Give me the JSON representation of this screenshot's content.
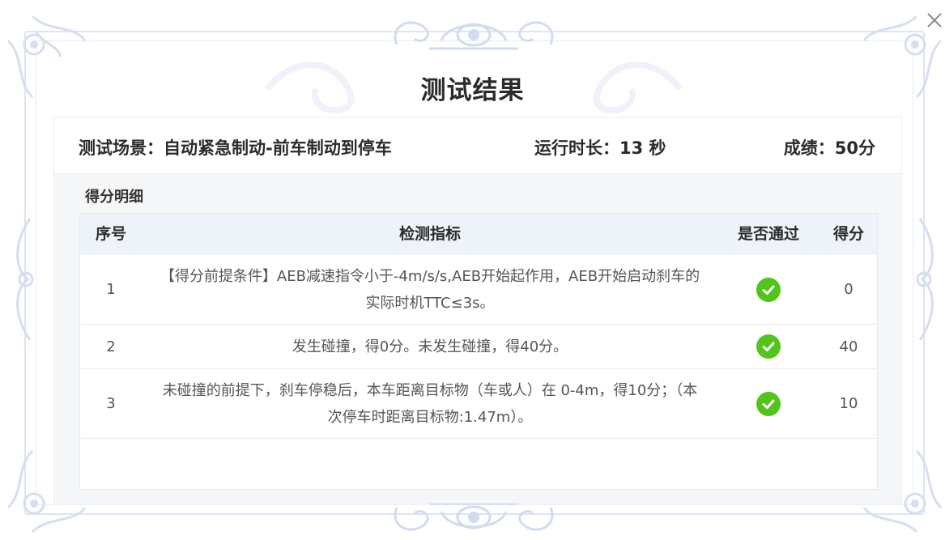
{
  "dialog": {
    "title": "测试结果",
    "close_icon": "close-icon"
  },
  "info": {
    "scene": "测试场景：自动紧急制动-前车制动到停车",
    "duration": "运行时长：13 秒",
    "score": "成绩：50分"
  },
  "detail_label": "得分明细",
  "table": {
    "headers": [
      "序号",
      "检测指标",
      "是否通过",
      "得分"
    ],
    "rows": [
      {
        "index": "1",
        "metric": "【得分前提条件】AEB减速指令小于-4m/s/s,AEB开始起作用，AEB开始启动刹车的实际时机TTC≤3s。",
        "passed": true,
        "score": "0"
      },
      {
        "index": "2",
        "metric": "发生碰撞，得0分。未发生碰撞，得40分。",
        "passed": true,
        "score": "40"
      },
      {
        "index": "3",
        "metric": "未碰撞的前提下，刹车停稳后，本车距离目标物（车或人）在 0-4m，得10分；（本次停车时距离目标物:1.47m）。",
        "passed": true,
        "score": "10"
      }
    ]
  },
  "colors": {
    "pass_green": "#52c41a",
    "header_bg": "#eef3fa",
    "frame": "#dde4f3"
  }
}
